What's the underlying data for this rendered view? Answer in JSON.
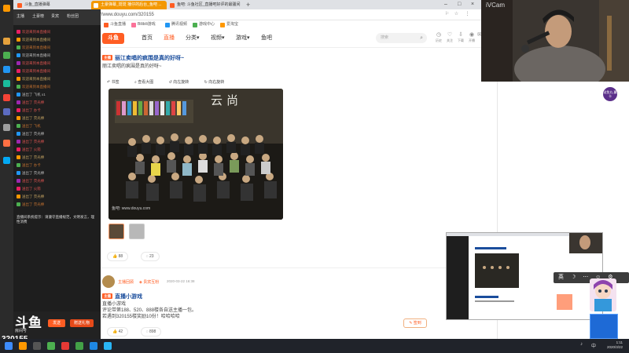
{
  "browser": {
    "tabs": [
      {
        "label": "斗鱼_直播弹幕"
      },
      {
        "label": "土豪弹幕_斑斑 播仔的后台_鱼吧 ..."
      },
      {
        "label": "鱼吧: 斗鱼社区_直播吧好评的最骚间"
      }
    ],
    "new_tab": "+",
    "url": "https://www.douyu.com/320155",
    "bookmarks": [
      "斗鱼直播",
      "Bilibili游戏",
      "腾讯视频",
      "游戏中心",
      "爱淘宝"
    ]
  },
  "douyu_header": {
    "logo": "斗鱼",
    "nav": [
      "首页",
      "直播",
      "分类",
      "视频",
      "游戏",
      "鱼吧"
    ],
    "search_placeholder": "搜索",
    "icons": [
      "历史",
      "关注",
      "下载",
      "开播",
      "消息"
    ]
  },
  "chat": {
    "top_controls": [
      "主播",
      "土豪榜",
      "贵宾",
      "粉丝团"
    ],
    "lines": [
      "欢迎来到本直播间",
      "欢迎来到本直播间",
      "欢迎来到本直播间",
      "欢迎来到本直播间",
      "欢迎来到本直播间",
      "欢迎来到本直播间",
      "欢迎来到本直播间",
      "欢迎来到本直播间",
      "送出了 飞机 x1",
      "送出了 荧光棒",
      "送出了 办卡",
      "送出了 荧光棒",
      "送出了 飞机",
      "送出了 荧光棒",
      "送出了 荧光棒",
      "送出了 火箭",
      "送出了 荧光棒",
      "送出了 办卡",
      "送出了 荧光棒",
      "送出了 荧光棒",
      "送出了 火箭",
      "送出了 荧光棒",
      "送出了 荧光棒"
    ],
    "notice": "直播间系统提示：请遵守直播规范，文明发言，理性消费",
    "room_logo": "斗鱼",
    "room_label": "房间号",
    "room_id": "320155",
    "buttons": [
      "发送",
      "赠送礼物"
    ]
  },
  "posts": [
    {
      "tag": "主播",
      "title": "丽江卖唱的疯围是真的好呀~",
      "body": "丽江卖唱的疯围是真的好呀~",
      "tools": [
        "书签",
        "查看大图",
        "向左旋转",
        "向右旋转"
      ],
      "photo_sign": "云尚",
      "photo_watermark": "鱼吧: www.douyu.com",
      "likes": "88",
      "comments": "23"
    },
    {
      "author": "主播回顾",
      "author_badge": "贵宾互粉",
      "date": "2020-03-22 16:38",
      "tag": "主播",
      "title": "直播小游戏",
      "body_lines": [
        "直播小游戏",
        "评论带第188、520、888楼各自送主播一包。",
        "若遇到320155楼奖励10份！哈哈哈哈"
      ],
      "likes": "42",
      "comments": "898"
    }
  ],
  "sign_button": "签到",
  "webcam_label": "iVCam",
  "dy_badge": "送鱼丸 赢卡",
  "ime": [
    "英",
    "☽",
    "⋯",
    "☺",
    "⚙"
  ],
  "taskbar": {
    "clock_time": "1:11",
    "clock_date": "2020/3/22",
    "lang": "中"
  }
}
